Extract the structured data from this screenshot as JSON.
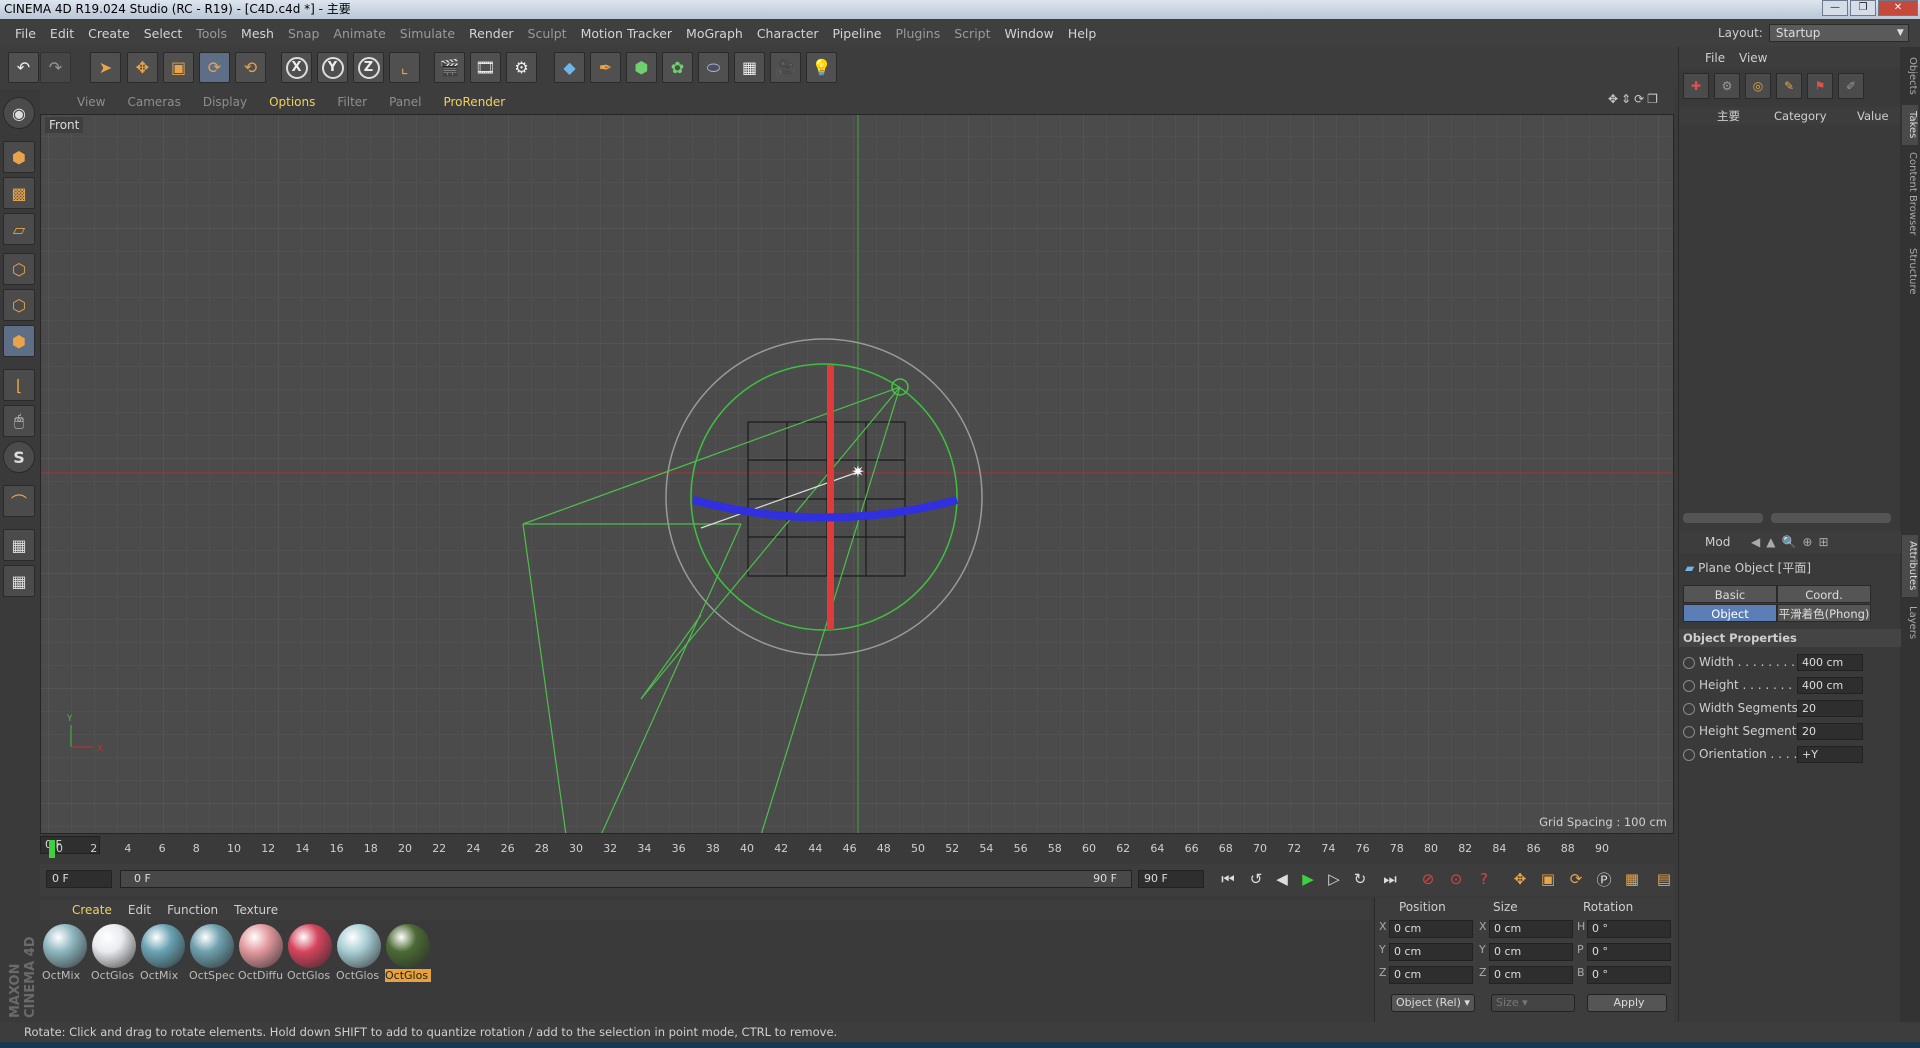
{
  "window": {
    "title": "CINEMA 4D R19.024 Studio (RC - R19) - [C4D.c4d *] - 主要"
  },
  "menu": [
    "File",
    "Edit",
    "Create",
    "Select",
    "Tools",
    "Mesh",
    "Snap",
    "Animate",
    "Simulate",
    "Render",
    "Sculpt",
    "Motion Tracker",
    "MoGraph",
    "Character",
    "Pipeline",
    "Plugins",
    "Script",
    "Window",
    "Help"
  ],
  "layout": {
    "label": "Layout:",
    "value": "Startup"
  },
  "viewport": {
    "menu": [
      "View",
      "Cameras",
      "Display",
      "Options",
      "Filter",
      "Panel",
      "ProRender"
    ],
    "name": "Front",
    "grid_spacing": "Grid Spacing : 100 cm",
    "axis_y": "Y",
    "axis_x": "X"
  },
  "timeline": {
    "ticks": [
      "0",
      "2",
      "4",
      "6",
      "8",
      "10",
      "12",
      "14",
      "16",
      "18",
      "20",
      "22",
      "24",
      "26",
      "28",
      "30",
      "32",
      "34",
      "36",
      "38",
      "40",
      "42",
      "44",
      "46",
      "48",
      "50",
      "52",
      "54",
      "56",
      "58",
      "60",
      "62",
      "64",
      "66",
      "68",
      "70",
      "72",
      "74",
      "76",
      "78",
      "80",
      "82",
      "84",
      "86",
      "88",
      "90"
    ],
    "current_frame": "0 F",
    "start": "0 F",
    "range_start": "0 F",
    "range_end": "90 F",
    "end": "90 F"
  },
  "material_manager": {
    "menu": [
      "Create",
      "Edit",
      "Function",
      "Texture"
    ],
    "materials": [
      {
        "label": "OctMix",
        "color": "#8fb7c0"
      },
      {
        "label": "OctGlos",
        "color": "#e9ecef"
      },
      {
        "label": "OctMix",
        "color": "#6aa3b4"
      },
      {
        "label": "OctSpec",
        "color": "#6fa0ad"
      },
      {
        "label": "OctDiffu",
        "color": "#e39a9e"
      },
      {
        "label": "OctGlos",
        "color": "#d6455e"
      },
      {
        "label": "OctGlos",
        "color": "#a9cfd6"
      },
      {
        "label": "OctGlos",
        "color": "#4b6a34"
      }
    ]
  },
  "maxon": "MAXON CINEMA 4D",
  "coords": {
    "headers": [
      "Position",
      "Size",
      "Rotation"
    ],
    "rows": [
      {
        "a": "X",
        "pos": "0 cm",
        "b": "X",
        "size": "0 cm",
        "c": "H",
        "rot": "0 °"
      },
      {
        "a": "Y",
        "pos": "0 cm",
        "b": "Y",
        "size": "0 cm",
        "c": "P",
        "rot": "0 °"
      },
      {
        "a": "Z",
        "pos": "0 cm",
        "b": "Z",
        "size": "0 cm",
        "c": "B",
        "rot": "0 °"
      }
    ],
    "mode": "Object (Rel)",
    "size_mode": "Size",
    "apply": "Apply"
  },
  "objects_panel": {
    "menu": [
      "File",
      "View"
    ],
    "root": "主要",
    "col_category": "Category",
    "col_value": "Value"
  },
  "attributes": {
    "mode": "Mod",
    "title": "Plane Object [平面]",
    "tabs": [
      "Basic",
      "Coord.",
      "Object",
      "平滑着色(Phong)"
    ],
    "section": "Object Properties",
    "props": [
      {
        "name": "Width . . . . . . . . .",
        "value": "400 cm"
      },
      {
        "name": "Height . . . . . . . . .",
        "value": "400 cm"
      },
      {
        "name": "Width Segments",
        "value": "20"
      },
      {
        "name": "Height Segments",
        "value": "20"
      },
      {
        "name": "Orientation . . . . .",
        "value": "+Y"
      }
    ]
  },
  "right_tabs": [
    "Objects",
    "Takes",
    "Content Browser",
    "Structure",
    "Attributes",
    "Layers"
  ],
  "status": "Rotate: Click and drag to rotate elements. Hold down SHIFT to add to quantize rotation / add to the selection in point mode, CTRL to remove."
}
